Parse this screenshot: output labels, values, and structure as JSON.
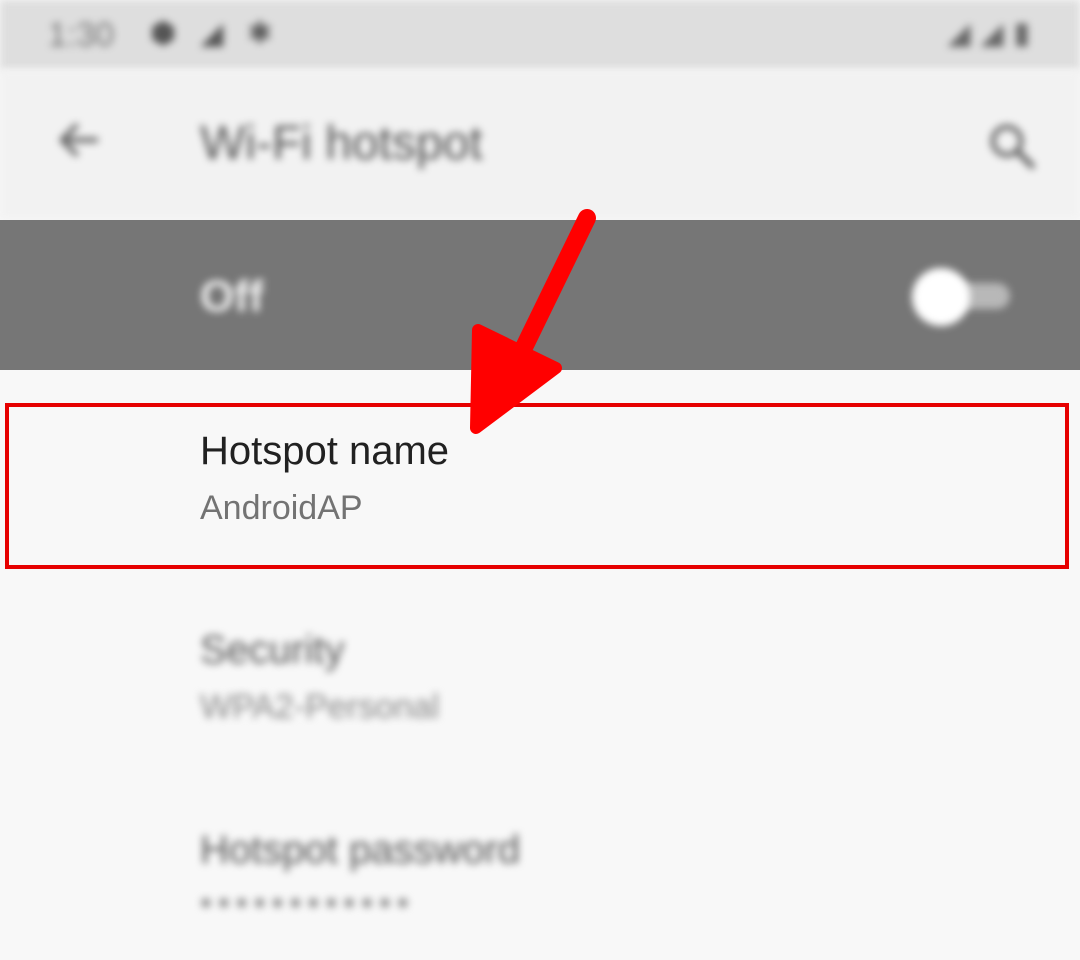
{
  "status_bar": {
    "time": "1:30",
    "left_icons": [
      "shield-icon",
      "signal-icon",
      "settings-gear-icon"
    ],
    "right_icons": [
      "wifi-icon",
      "signal-icon",
      "battery-icon"
    ]
  },
  "app_bar": {
    "title": "Wi-Fi hotspot",
    "back_icon": "back-arrow-icon",
    "search_icon": "search-icon"
  },
  "hotspot_toggle": {
    "label": "Off",
    "state": "off"
  },
  "settings": [
    {
      "title": "Hotspot name",
      "summary": "AndroidAP"
    },
    {
      "title": "Security",
      "summary": "WPA2-Personal"
    },
    {
      "title": "Hotspot password",
      "summary": "••••••••••••"
    }
  ],
  "annotation": {
    "highlight_color": "#e60000",
    "arrow_color": "#ff0000"
  }
}
